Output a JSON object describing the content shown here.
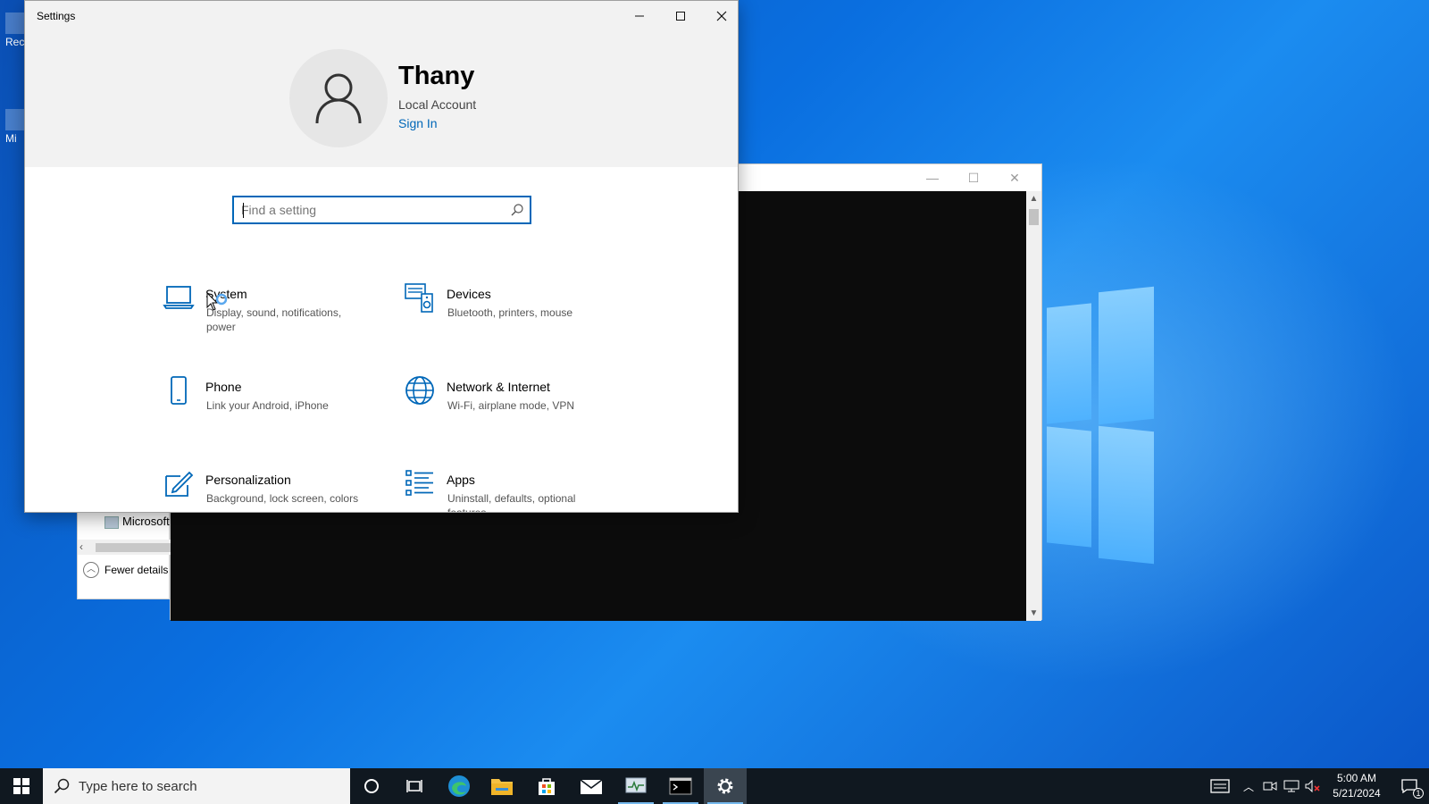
{
  "desktop": {
    "icons": [
      {
        "label": "Rec"
      },
      {
        "label": "Mi"
      }
    ]
  },
  "console_window": {
    "minimize": "—",
    "maximize": "☐",
    "close": "✕"
  },
  "task_manager": {
    "row_label": "Microsoft",
    "fewer_details": "Fewer details"
  },
  "settings": {
    "title": "Settings",
    "user": {
      "name": "Thany",
      "account_type": "Local Account",
      "sign_in": "Sign In"
    },
    "search": {
      "placeholder": "Find a setting"
    },
    "categories": [
      {
        "name": "System",
        "description": "Display, sound, notifications, power",
        "icon": "laptop-icon"
      },
      {
        "name": "Devices",
        "description": "Bluetooth, printers, mouse",
        "icon": "devices-icon"
      },
      {
        "name": "Phone",
        "description": "Link your Android, iPhone",
        "icon": "phone-icon"
      },
      {
        "name": "Network & Internet",
        "description": "Wi-Fi, airplane mode, VPN",
        "icon": "globe-icon"
      },
      {
        "name": "Personalization",
        "description": "Background, lock screen, colors",
        "icon": "personalization-icon"
      },
      {
        "name": "Apps",
        "description": "Uninstall, defaults, optional features",
        "icon": "apps-icon"
      }
    ],
    "accent_color": "#0067b8"
  },
  "taskbar": {
    "search_placeholder": "Type here to search",
    "clock": {
      "time": "5:00 AM",
      "date": "5/21/2024"
    },
    "notification_count": "1"
  }
}
